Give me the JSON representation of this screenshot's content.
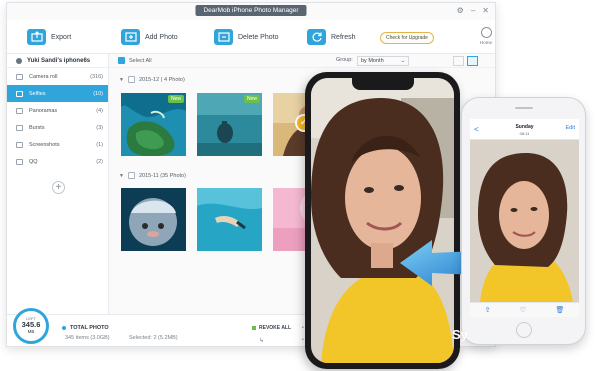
{
  "window": {
    "title": "DearMob iPhone Photo Manager"
  },
  "toolbar": {
    "export_label": "Export",
    "add_photo_label": "Add Photo",
    "delete_photo_label": "Delete Photo",
    "refresh_label": "Refresh",
    "upgrade_label": "Check for Upgrade",
    "home_label": "Home"
  },
  "sidebar": {
    "device_name": "Yuki Sandi's iphone6s",
    "items": [
      {
        "label": "Camera roll",
        "count": "(316)"
      },
      {
        "label": "Selfies",
        "count": "(10)"
      },
      {
        "label": "Panoramas",
        "count": "(4)"
      },
      {
        "label": "Bursts",
        "count": "(3)"
      },
      {
        "label": "Screenshots",
        "count": "(1)"
      },
      {
        "label": "QQ",
        "count": "(2)"
      }
    ]
  },
  "content": {
    "select_all_label": "Select All",
    "group_label": "Group:",
    "group_value": "by Month",
    "sections": [
      {
        "label": "2015-12 ( 4 Photo)"
      },
      {
        "label": "2015-11 (35 Photo)"
      }
    ],
    "new_badge": "New"
  },
  "footer": {
    "gauge_label": "LEFT",
    "gauge_value": "345.6",
    "gauge_unit": "MB",
    "total_label": "TOTAL PHOTO",
    "items_text": "345 items (3.0GB)",
    "selected_text": "Selected: 2 (5.2MB)",
    "revoke_label": "REVOKE ALL",
    "add_text": "Ad",
    "del_text": "De"
  },
  "phone8": {
    "back": "<",
    "day": "Sunday",
    "date": "08:11",
    "edit": "Edit"
  },
  "overlay_text": "Sy",
  "colors": {
    "accent": "#2fa5dc",
    "new_badge": "#6cc04a",
    "selected_check": "#f5b921"
  }
}
